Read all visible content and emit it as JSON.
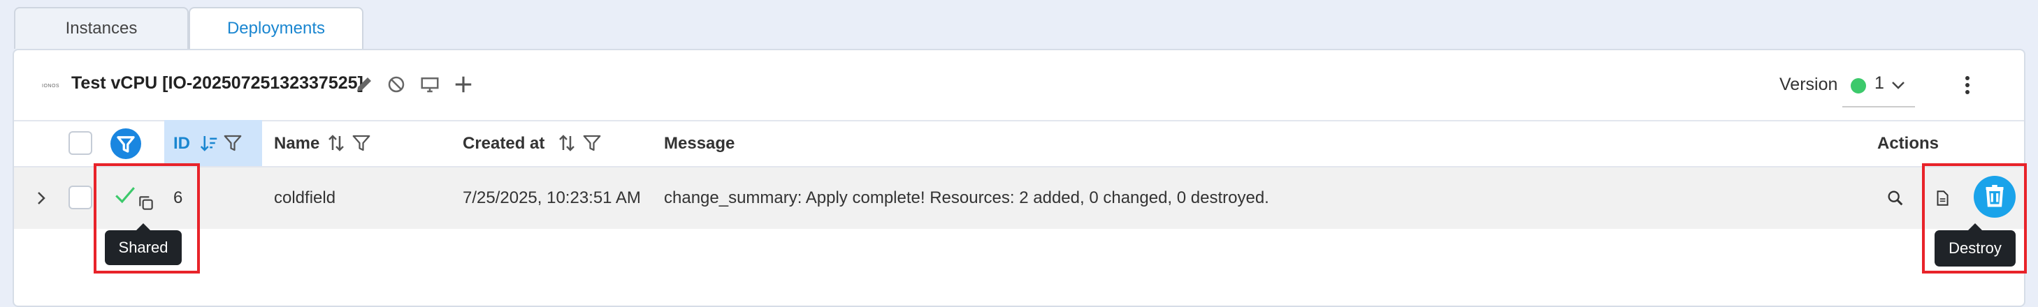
{
  "tabs": [
    {
      "label": "Instances"
    },
    {
      "label": "Deployments"
    }
  ],
  "header": {
    "logo_text": "IONOS",
    "title": "Test vCPU [IO-20250725132337525]",
    "version_label": "Version",
    "version_value": "1",
    "version_status_color": "#3cc96b",
    "icons": [
      "pencil-icon",
      "ban-icon",
      "monitor-icon",
      "plus-icon",
      "kebab-menu-icon"
    ]
  },
  "table": {
    "columns": {
      "id": "ID",
      "name": "Name",
      "created_at": "Created at",
      "message": "Message",
      "actions": "Actions"
    },
    "rows": [
      {
        "id": "6",
        "name": "coldfield",
        "created_at": "7/25/2025, 10:23:51 AM",
        "message": "change_summary: Apply complete! Resources: 2 added, 0 changed, 0 destroyed."
      }
    ]
  },
  "tooltips": {
    "shared": "Shared",
    "destroy": "Destroy"
  },
  "colors": {
    "accent": "#1a86e0",
    "highlight": "#e8232a",
    "success": "#3cc96b"
  }
}
